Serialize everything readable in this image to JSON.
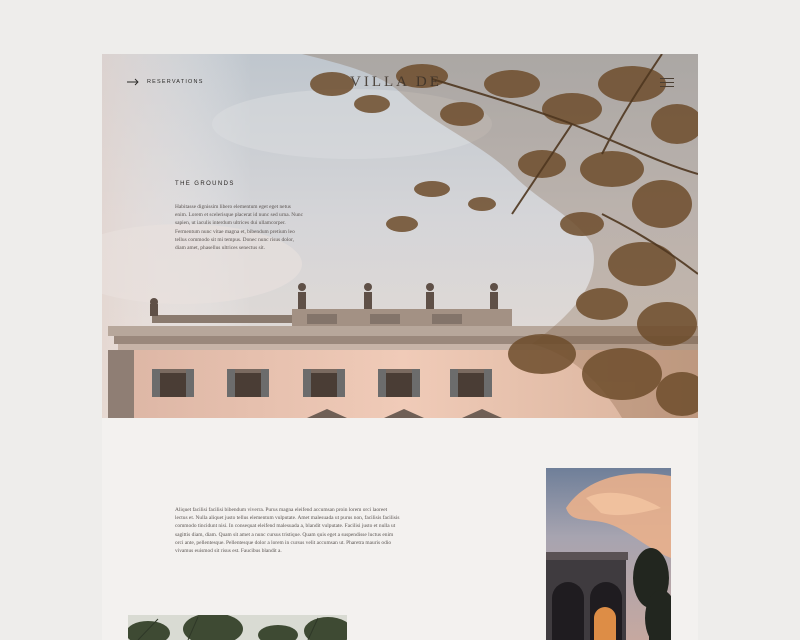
{
  "header": {
    "reservations_label": "RESERVATIONS",
    "logo_text": "VILLA DE"
  },
  "grounds": {
    "title": "THE GROUNDS",
    "body": "Habitasse dignissim libero elementum eget eget netus enim. Lorem et scelerisque placerat id nunc sed urna. Nunc sapien, ut iaculis interdum ultrices dui ullamcorper. Fermentum nunc vitae magna et, bibendum pretium leo tellus commodo sit mi tempus. Donec nunc risus dolor, diam amet, phasellus ultrices senectus sit."
  },
  "section": {
    "body": "Aliquet facilisi facilisi bibendum viverra. Purus magna eleifend accumsan proin lorem orci laoreet lectus et. Nulla aliquet justo tellus elementum vulputate. Amet malesuada ut purus non, facilisis facilisis commodo tincidunt nisi. In consequat eleifend malesuada a, blandit vulputate. Facilisi justo et nulla ut sagittis diam, diam. Quam sit amet a nunc cursus tristique. Quam quis eget a suspendisse luctus enim orci ante, pellentesque. Pellentesque dolor a lorem in cursus velit accumsan ut. Pharetra mauris odio vivamus euismod sit risus est. Faucibus blandit a."
  },
  "icons": {
    "arrow": "arrow-right-icon",
    "menu": "hamburger-menu-icon"
  },
  "colors": {
    "page_bg": "#eeedeb",
    "card_bg": "#f3f1ef",
    "text_dark": "#2a2624",
    "text_body": "#5a5350",
    "facade": "#ecc7b5",
    "foliage": "#6e4d2c"
  }
}
